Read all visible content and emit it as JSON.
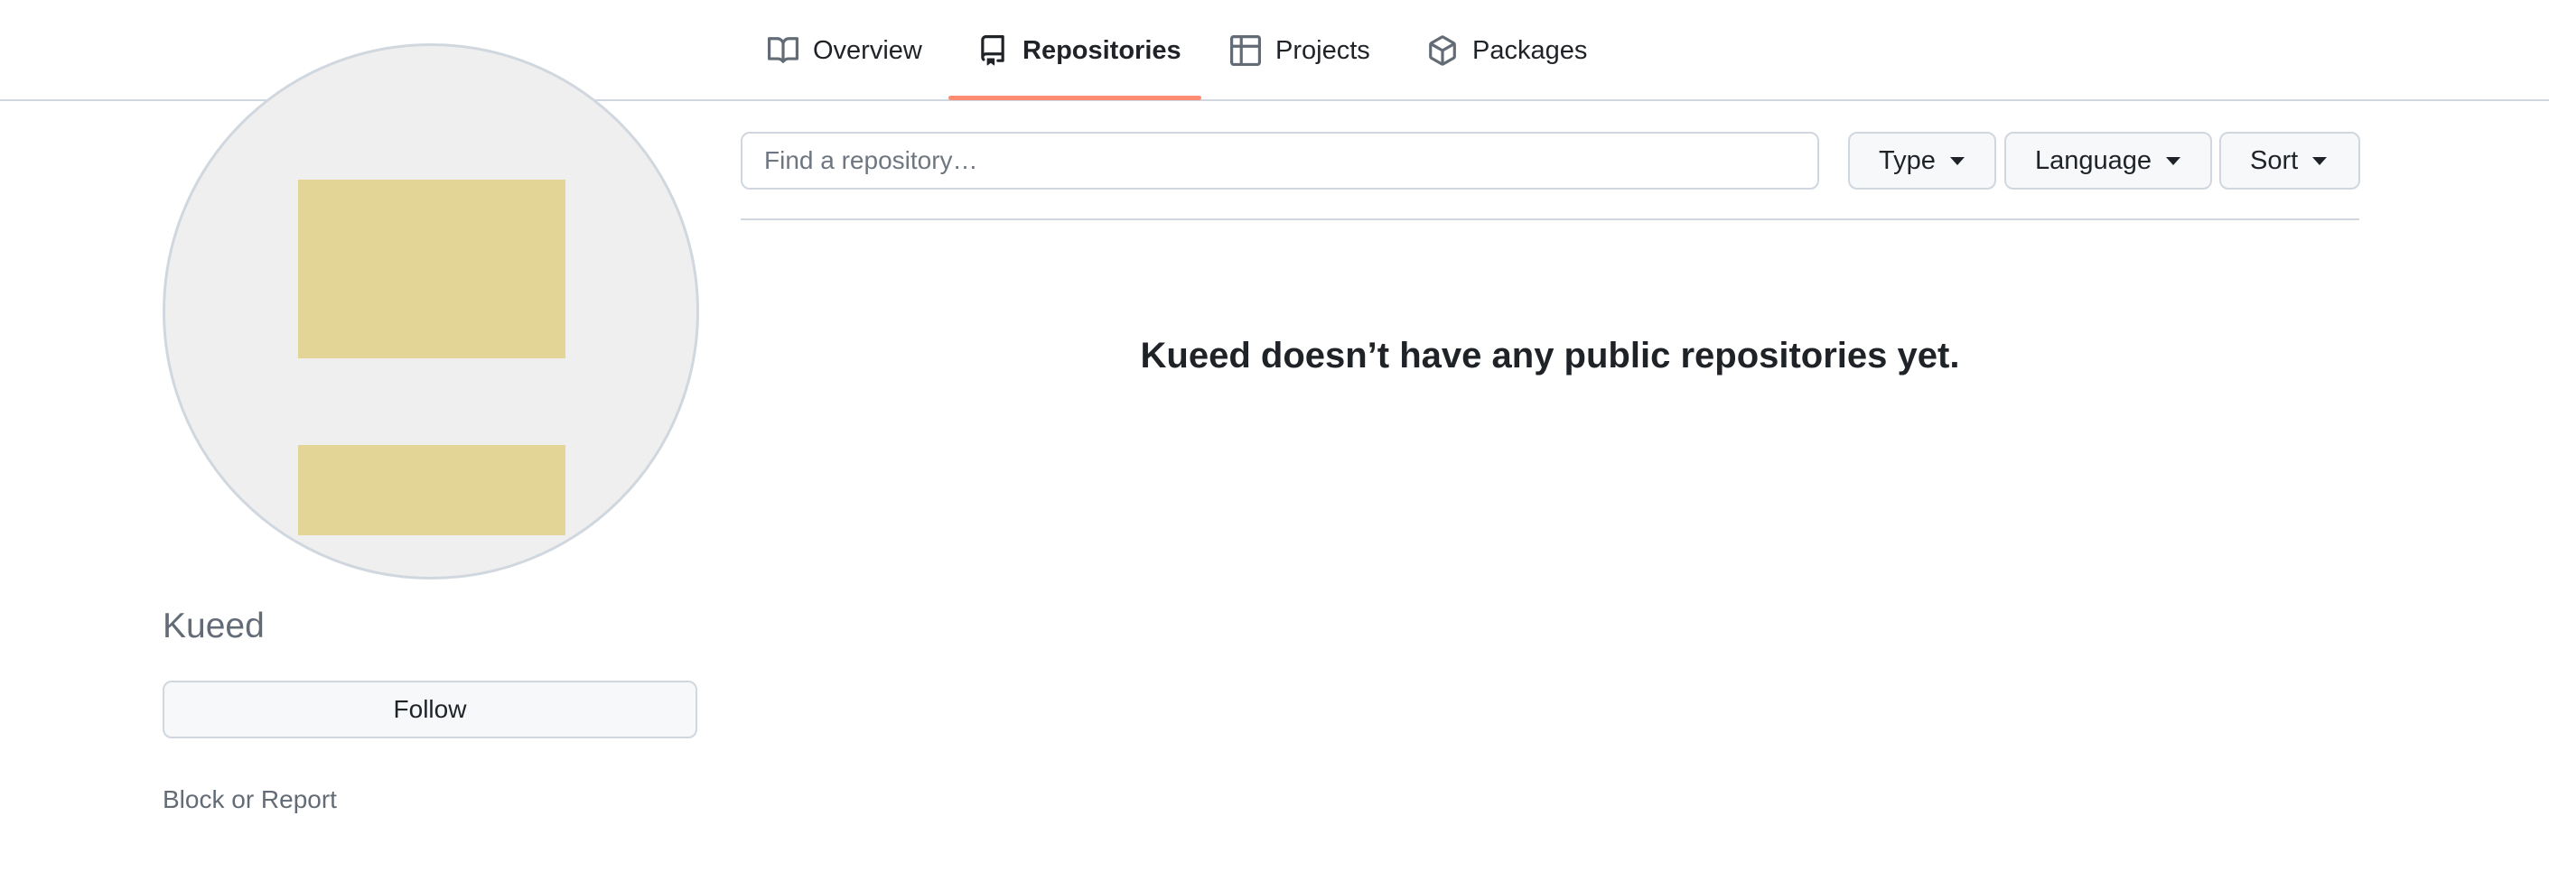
{
  "nav": {
    "tabs": [
      {
        "label": "Overview",
        "icon": "book-icon",
        "selected": false
      },
      {
        "label": "Repositories",
        "icon": "repo-icon",
        "selected": true
      },
      {
        "label": "Projects",
        "icon": "table-icon",
        "selected": false
      },
      {
        "label": "Packages",
        "icon": "package-icon",
        "selected": false
      }
    ],
    "accent_color": "#fd8c73"
  },
  "profile": {
    "name": "Kueed",
    "follow_label": "Follow",
    "block_label": "Block or Report"
  },
  "repos": {
    "search_placeholder": "Find a repository…",
    "filters": {
      "type": "Type",
      "language": "Language",
      "sort": "Sort"
    },
    "empty_message": "Kueed doesn’t have any public repositories yet."
  }
}
